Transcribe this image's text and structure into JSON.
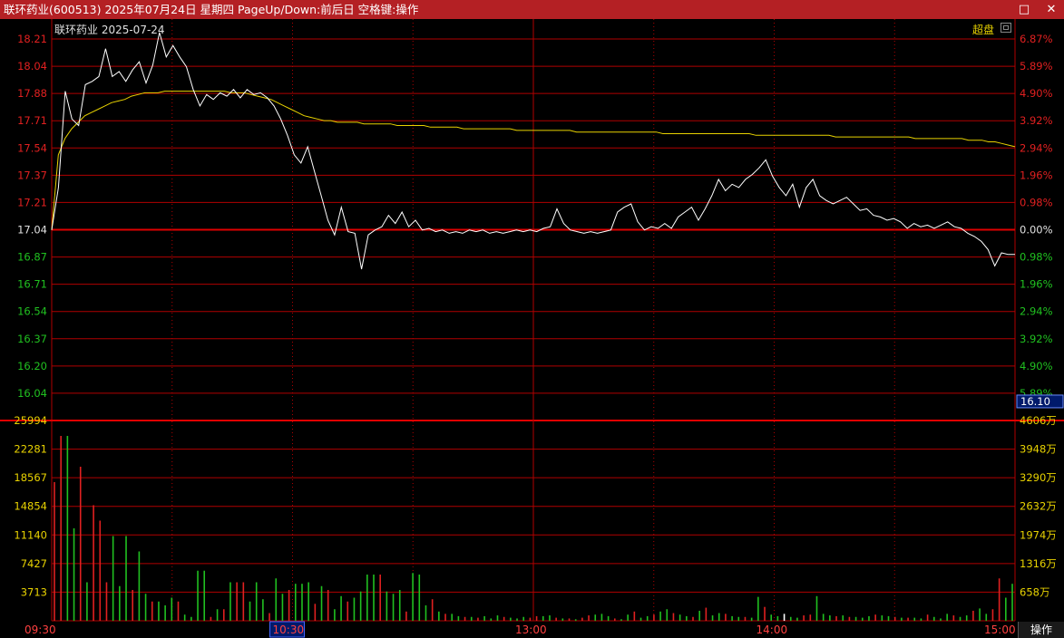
{
  "window": {
    "title": "联环药业(600513)  2025年07月24日  星期四  PageUp/Down:前后日  空格键:操作",
    "buttons": [
      "□",
      "✕"
    ]
  },
  "header": {
    "stock_label": "联环药业    2025-07-24",
    "mode_label": "超盘"
  },
  "footer": {
    "ops_button": "操作"
  },
  "colors": {
    "up": "#e02020",
    "down": "#20c020",
    "price_line": "#ffffff",
    "avg_line": "#e8d200",
    "grid": "#b00000",
    "base_line": "#e00000"
  },
  "chart_data": [
    {
      "type": "line",
      "title": "",
      "y_left_ticks": [
        "18.21",
        "18.04",
        "17.88",
        "17.71",
        "17.54",
        "17.37",
        "17.21",
        "17.04",
        "16.87",
        "16.71",
        "16.54",
        "16.37",
        "16.20",
        "16.04"
      ],
      "y_right_ticks": [
        "6.87%",
        "5.89%",
        "4.90%",
        "3.92%",
        "2.94%",
        "1.96%",
        "0.98%",
        "0.00%",
        "0.98%",
        "1.96%",
        "2.94%",
        "3.92%",
        "4.90%",
        "5.89%"
      ],
      "ylim": [
        16.04,
        18.21
      ],
      "prev_close": 17.04,
      "cursor_price": "16.10",
      "x_labels": [
        "09:30",
        "10:30",
        "13:00",
        "14:00",
        "15:00"
      ],
      "highlight_x_label": "10:30",
      "series": [
        {
          "values": [
            17.04,
            17.3,
            17.89,
            17.72,
            17.68,
            17.93,
            17.95,
            17.98,
            18.15,
            17.98,
            18.01,
            17.95,
            18.02,
            18.07,
            17.94,
            18.05,
            18.25,
            18.1,
            18.17,
            18.1,
            18.04,
            17.9,
            17.8,
            17.87,
            17.84,
            17.88,
            17.86,
            17.9,
            17.85,
            17.9,
            17.87,
            17.88,
            17.85,
            17.8,
            17.72,
            17.62,
            17.5,
            17.45,
            17.55,
            17.4,
            17.25,
            17.1,
            17.01,
            17.18,
            17.03,
            17.02,
            16.8,
            17.01,
            17.04,
            17.06,
            17.13,
            17.08,
            17.15,
            17.06,
            17.1,
            17.04,
            17.05,
            17.03,
            17.04,
            17.02,
            17.03,
            17.02,
            17.04,
            17.03,
            17.04,
            17.02,
            17.03,
            17.02,
            17.03,
            17.04,
            17.03,
            17.04,
            17.03,
            17.05,
            17.06,
            17.17,
            17.08,
            17.04,
            17.03,
            17.02,
            17.03,
            17.02,
            17.03,
            17.04,
            17.15,
            17.18,
            17.2,
            17.09,
            17.04,
            17.06,
            17.05,
            17.08,
            17.05,
            17.12,
            17.15,
            17.18,
            17.1,
            17.17,
            17.25,
            17.35,
            17.28,
            17.32,
            17.3,
            17.35,
            17.38,
            17.42,
            17.47,
            17.37,
            17.3,
            17.25,
            17.32,
            17.18,
            17.3,
            17.35,
            17.25,
            17.22,
            17.2,
            17.22,
            17.24,
            17.2,
            17.16,
            17.17,
            17.13,
            17.12,
            17.1,
            17.11,
            17.09,
            17.05,
            17.08,
            17.06,
            17.07,
            17.05,
            17.07,
            17.09,
            17.06,
            17.05,
            17.02,
            17.0,
            16.97,
            16.92,
            16.82,
            16.9,
            16.89,
            16.89
          ]
        },
        {
          "values": [
            17.04,
            17.5,
            17.6,
            17.66,
            17.7,
            17.74,
            17.76,
            17.78,
            17.8,
            17.82,
            17.83,
            17.84,
            17.86,
            17.87,
            17.88,
            17.88,
            17.88,
            17.89,
            17.89,
            17.89,
            17.89,
            17.89,
            17.89,
            17.89,
            17.89,
            17.89,
            17.89,
            17.88,
            17.88,
            17.88,
            17.87,
            17.86,
            17.85,
            17.84,
            17.82,
            17.8,
            17.78,
            17.76,
            17.74,
            17.73,
            17.72,
            17.71,
            17.71,
            17.7,
            17.7,
            17.7,
            17.7,
            17.69,
            17.69,
            17.69,
            17.69,
            17.69,
            17.68,
            17.68,
            17.68,
            17.68,
            17.68,
            17.67,
            17.67,
            17.67,
            17.67,
            17.67,
            17.66,
            17.66,
            17.66,
            17.66,
            17.66,
            17.66,
            17.66,
            17.66,
            17.65,
            17.65,
            17.65,
            17.65,
            17.65,
            17.65,
            17.65,
            17.65,
            17.65,
            17.64,
            17.64,
            17.64,
            17.64,
            17.64,
            17.64,
            17.64,
            17.64,
            17.64,
            17.64,
            17.64,
            17.64,
            17.64,
            17.63,
            17.63,
            17.63,
            17.63,
            17.63,
            17.63,
            17.63,
            17.63,
            17.63,
            17.63,
            17.63,
            17.63,
            17.63,
            17.63,
            17.62,
            17.62,
            17.62,
            17.62,
            17.62,
            17.62,
            17.62,
            17.62,
            17.62,
            17.62,
            17.62,
            17.62,
            17.61,
            17.61,
            17.61,
            17.61,
            17.61,
            17.61,
            17.61,
            17.61,
            17.61,
            17.61,
            17.61,
            17.61,
            17.6,
            17.6,
            17.6,
            17.6,
            17.6,
            17.6,
            17.6,
            17.6,
            17.59,
            17.59,
            17.59,
            17.58,
            17.58,
            17.57,
            17.56,
            17.55
          ]
        }
      ]
    },
    {
      "type": "bar",
      "title": "",
      "y_left_ticks": [
        "25994",
        "22281",
        "18567",
        "14854",
        "11140",
        "7427",
        "3713"
      ],
      "y_right_ticks": [
        "4606万",
        "3948万",
        "3290万",
        "2632万",
        "1974万",
        "1316万",
        "658万"
      ],
      "ylim": [
        0,
        25994
      ],
      "values": [
        18000,
        24000,
        24000,
        12000,
        20000,
        5000,
        15000,
        13000,
        5000,
        11000,
        4500,
        11000,
        4000,
        9000,
        3500,
        2500,
        2500,
        2000,
        3000,
        2500,
        800,
        500,
        6500,
        6500,
        500,
        1500,
        1500,
        5000,
        5000,
        5000,
        2500,
        5000,
        2800,
        1000,
        5500,
        3500,
        4000,
        4800,
        4800,
        5000,
        2200,
        4500,
        4000,
        1500,
        3200,
        2500,
        3000,
        3800,
        6000,
        6000,
        6000,
        3800,
        3500,
        4000,
        1200,
        6200,
        6000,
        2000,
        2800,
        1200,
        900,
        900,
        600,
        500,
        500,
        400,
        600,
        300,
        700,
        500,
        400,
        300,
        500,
        400,
        600,
        600,
        700,
        400,
        300,
        300,
        200,
        400,
        700,
        800,
        900,
        600,
        300,
        200,
        800,
        1200,
        400,
        600,
        800,
        1200,
        1500,
        1000,
        800,
        600,
        500,
        1300,
        1700,
        700,
        1000,
        900,
        600,
        500,
        500,
        400,
        3100,
        1800,
        800,
        600,
        900,
        500,
        400,
        700,
        800,
        3200,
        900,
        700,
        600,
        700,
        500,
        500,
        400,
        600,
        800,
        700,
        600,
        500,
        400,
        400,
        400,
        300,
        800,
        500,
        300,
        900,
        700,
        500,
        700,
        1300,
        1600,
        900,
        1500,
        5500,
        3000,
        4800
      ],
      "value_colors": [
        "r",
        "r",
        "g",
        "g",
        "r",
        "g",
        "r",
        "r",
        "r",
        "g",
        "g",
        "g",
        "r",
        "g",
        "g",
        "r",
        "g",
        "g",
        "g",
        "r",
        "g",
        "g",
        "g",
        "g",
        "r",
        "g",
        "r",
        "g",
        "r",
        "r",
        "g",
        "g",
        "g",
        "r",
        "g",
        "g",
        "r",
        "g",
        "g",
        "g",
        "r",
        "g",
        "r",
        "g",
        "g",
        "r",
        "g",
        "g",
        "g",
        "g",
        "r",
        "g",
        "g",
        "g",
        "r",
        "g",
        "g",
        "g",
        "r",
        "g",
        "r",
        "g",
        "g",
        "r",
        "g",
        "r",
        "g",
        "g",
        "g",
        "r",
        "g",
        "g",
        "g",
        "r",
        "r",
        "g",
        "g",
        "r",
        "g",
        "r",
        "g",
        "r",
        "r",
        "g",
        "g",
        "g",
        "r",
        "g",
        "g",
        "r",
        "g",
        "g",
        "r",
        "g",
        "g",
        "r",
        "g",
        "g",
        "r",
        "g",
        "r",
        "g",
        "g",
        "r",
        "g",
        "g",
        "r",
        "g",
        "g",
        "r",
        "g",
        "g",
        "w",
        "g",
        "g",
        "r",
        "r",
        "g",
        "g",
        "g",
        "r",
        "g",
        "r",
        "g",
        "g",
        "g",
        "r",
        "g",
        "g",
        "r",
        "g",
        "r",
        "g",
        "g",
        "r",
        "g",
        "g",
        "g",
        "r",
        "g",
        "g",
        "r",
        "g",
        "g",
        "r",
        "r",
        "g",
        "g",
        "g"
      ]
    }
  ]
}
